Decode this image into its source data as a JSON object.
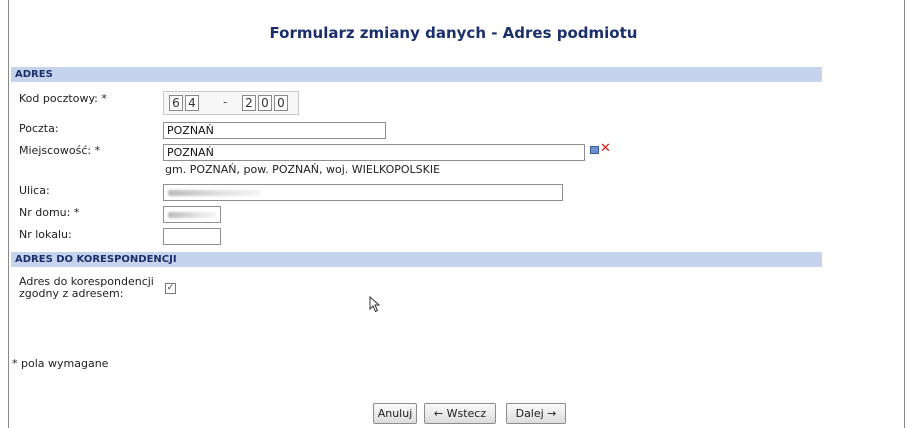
{
  "title": "Formularz zmiany danych - Adres podmiotu",
  "section_adres": "ADRES",
  "fields": {
    "kod_label": "Kod pocztowy: *",
    "kod_digits": [
      "6",
      "4",
      "2",
      "0",
      "0"
    ],
    "kod_separator": "-",
    "poczta_label": "Poczta:",
    "poczta_value": "POZNAŃ",
    "miejscowosc_label": "Miejscowość: *",
    "miejscowosc_value": "POZNAŃ",
    "miejscowosc_hint": "gm. POZNAŃ, pow. POZNAŃ, woj. WIELKOPOLSKIE",
    "ulica_label": "Ulica:",
    "nr_domu_label": "Nr domu: *",
    "nr_lokalu_label": "Nr lokalu:",
    "nr_lokalu_value": ""
  },
  "section_korespondencja": "ADRES DO KORESPONDENCJI",
  "korespondencja": {
    "label_line1": "Adres do korespondencji",
    "label_line2": "zgodny z adresem:",
    "checked": true
  },
  "required_note": "* pola wymagane",
  "buttons": {
    "anuluj": "Anuluj",
    "wstecz": "← Wstecz",
    "dalej": "Dalej →"
  },
  "icons": {
    "lookup": "table-icon",
    "clear": "clear-x-icon"
  },
  "colors": {
    "title": "#1a2f6b",
    "section_bg": "#c5d4ec",
    "clear_icon": "#d01818"
  }
}
